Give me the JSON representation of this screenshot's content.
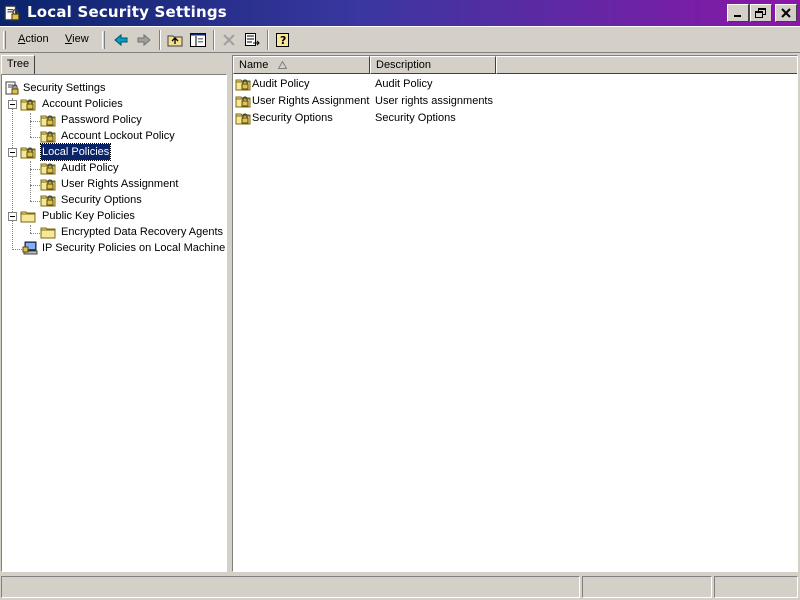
{
  "window": {
    "title": "Local Security Settings",
    "controls": [
      "minimize",
      "restore",
      "close"
    ]
  },
  "menu": {
    "action": "Action",
    "action_mnemonic": "A",
    "action_rest": "ction",
    "view": "View",
    "view_mnemonic": "V",
    "view_rest": "iew"
  },
  "toolbar_icons": [
    "back-arrow-icon",
    "forward-arrow-icon",
    "up-folder-icon",
    "show-hide-tree-icon",
    "delete-icon",
    "export-list-icon",
    "help-icon"
  ],
  "tree_tab": "Tree",
  "tree": {
    "root": "Security Settings",
    "account_policies": "Account Policies",
    "password_policy": "Password Policy",
    "account_lockout_policy": "Account Lockout Policy",
    "local_policies": "Local Policies",
    "audit_policy": "Audit Policy",
    "user_rights_assignment": "User Rights Assignment",
    "security_options": "Security Options",
    "public_key_policies": "Public Key Policies",
    "encrypted_data_recovery_agents": "Encrypted Data Recovery Agents",
    "ip_security_policies": "IP Security Policies on Local Machine",
    "selected": "Local Policies"
  },
  "list": {
    "columns": [
      "Name",
      "Description",
      ""
    ],
    "sort_column": "Name",
    "sort_direction": "ascending",
    "rows": [
      {
        "name": "Audit Policy",
        "description": "Audit Policy"
      },
      {
        "name": "User Rights Assignment",
        "description": "User rights assignments"
      },
      {
        "name": "Security Options",
        "description": "Security Options"
      }
    ]
  },
  "colors": {
    "title_gradient_start": "#0a246a",
    "title_gradient_end": "#8b17a8",
    "selection": "#0a246a",
    "face": "#d4d0c8"
  }
}
